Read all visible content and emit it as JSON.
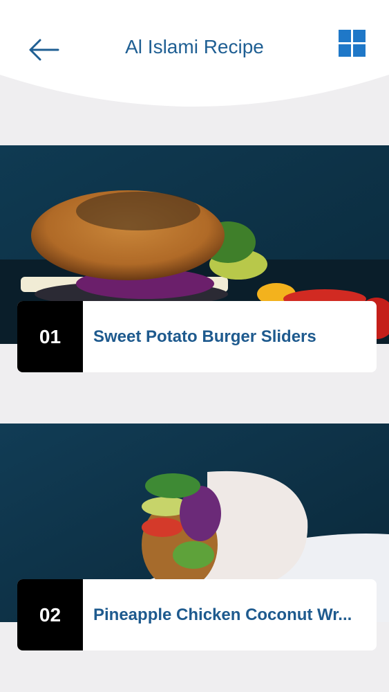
{
  "header": {
    "title": "Al Islami Recipe",
    "back_icon": "arrow-left-icon",
    "menu_icon": "grid-icon",
    "accent_color": "#1f5f93"
  },
  "recipes": [
    {
      "number": "01",
      "name": "Sweet Potato Burger Sliders"
    },
    {
      "number": "02",
      "name": "Pineapple Chicken Coconut Wr..."
    }
  ]
}
